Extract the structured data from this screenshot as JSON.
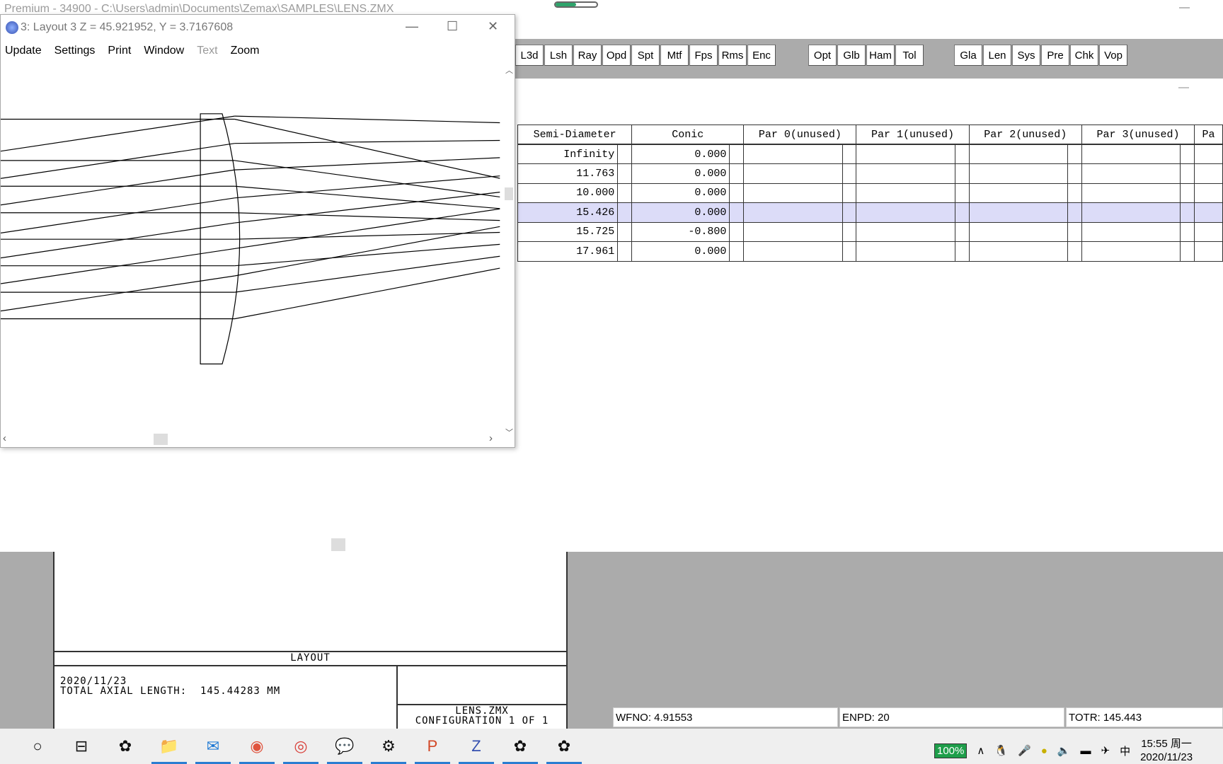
{
  "app": {
    "title": "Premium - 34900 - C:\\Users\\admin\\Documents\\Zemax\\SAMPLES\\LENS.ZMX"
  },
  "toolbar": {
    "buttons": [
      "L3d",
      "Lsh",
      "Ray",
      "Opd",
      "Spt",
      "Mtf",
      "Fps",
      "Rms",
      "Enc",
      "Opt",
      "Glb",
      "Ham",
      "Tol",
      "Gla",
      "Len",
      "Sys",
      "Pre",
      "Chk",
      "Vop"
    ]
  },
  "layout_window": {
    "title": "3: Layout 3 Z = 45.921952, Y = 3.7167608",
    "menu": [
      "Update",
      "Settings",
      "Print",
      "Window",
      "Text",
      "Zoom"
    ],
    "disabled_menu": "Text"
  },
  "editor": {
    "columns": [
      "Semi-Diameter",
      "Conic",
      "Par 0(unused)",
      "Par 1(unused)",
      "Par 2(unused)",
      "Par 3(unused)",
      "Pa"
    ],
    "rows": [
      {
        "semi": "Infinity",
        "conic": "0.000"
      },
      {
        "semi": "11.763",
        "conic": "0.000"
      },
      {
        "semi": "10.000",
        "conic": "0.000"
      },
      {
        "semi": "15.426",
        "conic": "0.000",
        "selected": true
      },
      {
        "semi": "15.725",
        "conic": "-0.800"
      },
      {
        "semi": "17.961",
        "conic": "0.000"
      }
    ],
    "selected_color": "#dcdcf8"
  },
  "plot_page": {
    "label": "LAYOUT",
    "date": "2020/11/23",
    "length": "TOTAL AXIAL LENGTH:  145.44283 MM",
    "file": "LENS.ZMX",
    "config": "CONFIGURATION 1 OF 1"
  },
  "status": {
    "wfno": "WFNO: 4.91553",
    "enpd": "ENPD: 20",
    "totr": "TOTR: 145.443"
  },
  "taskbar": {
    "icons": [
      "search-icon",
      "task-view-icon",
      "app-icon",
      "file-explorer-icon",
      "mail-icon",
      "photos-icon",
      "chrome-icon",
      "wechat-icon",
      "settings-icon",
      "powerpoint-icon",
      "zemax-icon",
      "app-icon",
      "app-icon"
    ],
    "battery": "100%",
    "time": "15:55 周一",
    "date": "2020/11/23",
    "ime": "中"
  }
}
